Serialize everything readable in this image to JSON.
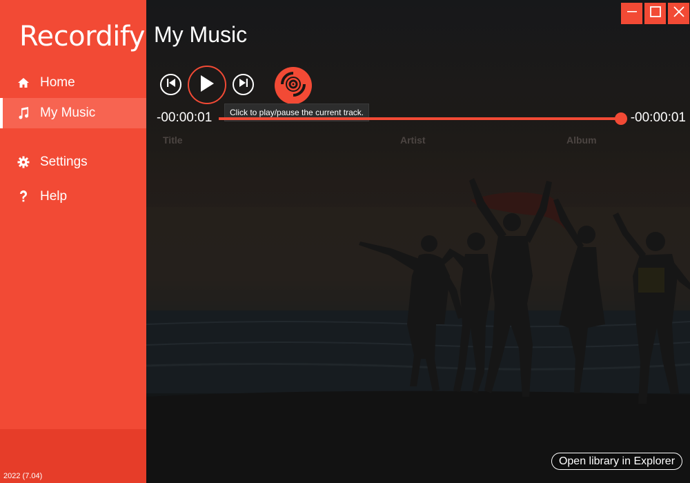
{
  "app": {
    "logo_text": "Recordify",
    "version": "2022 (7.04)"
  },
  "sidebar": {
    "items": [
      {
        "label": "Home",
        "icon": "home-icon",
        "active": false
      },
      {
        "label": "My Music",
        "icon": "music-note-icon",
        "active": true
      },
      {
        "label": "Settings",
        "icon": "gear-icon",
        "active": false
      },
      {
        "label": "Help",
        "icon": "question-icon",
        "active": false
      }
    ]
  },
  "main": {
    "title": "My Music",
    "player": {
      "tooltip": "Click to play/pause the current track.",
      "time_elapsed": "-00:00:01",
      "time_remaining": "-00:00:01",
      "progress": 1.0
    },
    "columns": [
      "Title",
      "Artist",
      "Album"
    ],
    "open_library_label": "Open library in Explorer"
  },
  "colors": {
    "accent": "#f24a35",
    "sidebar_bottom": "#e63d29"
  }
}
